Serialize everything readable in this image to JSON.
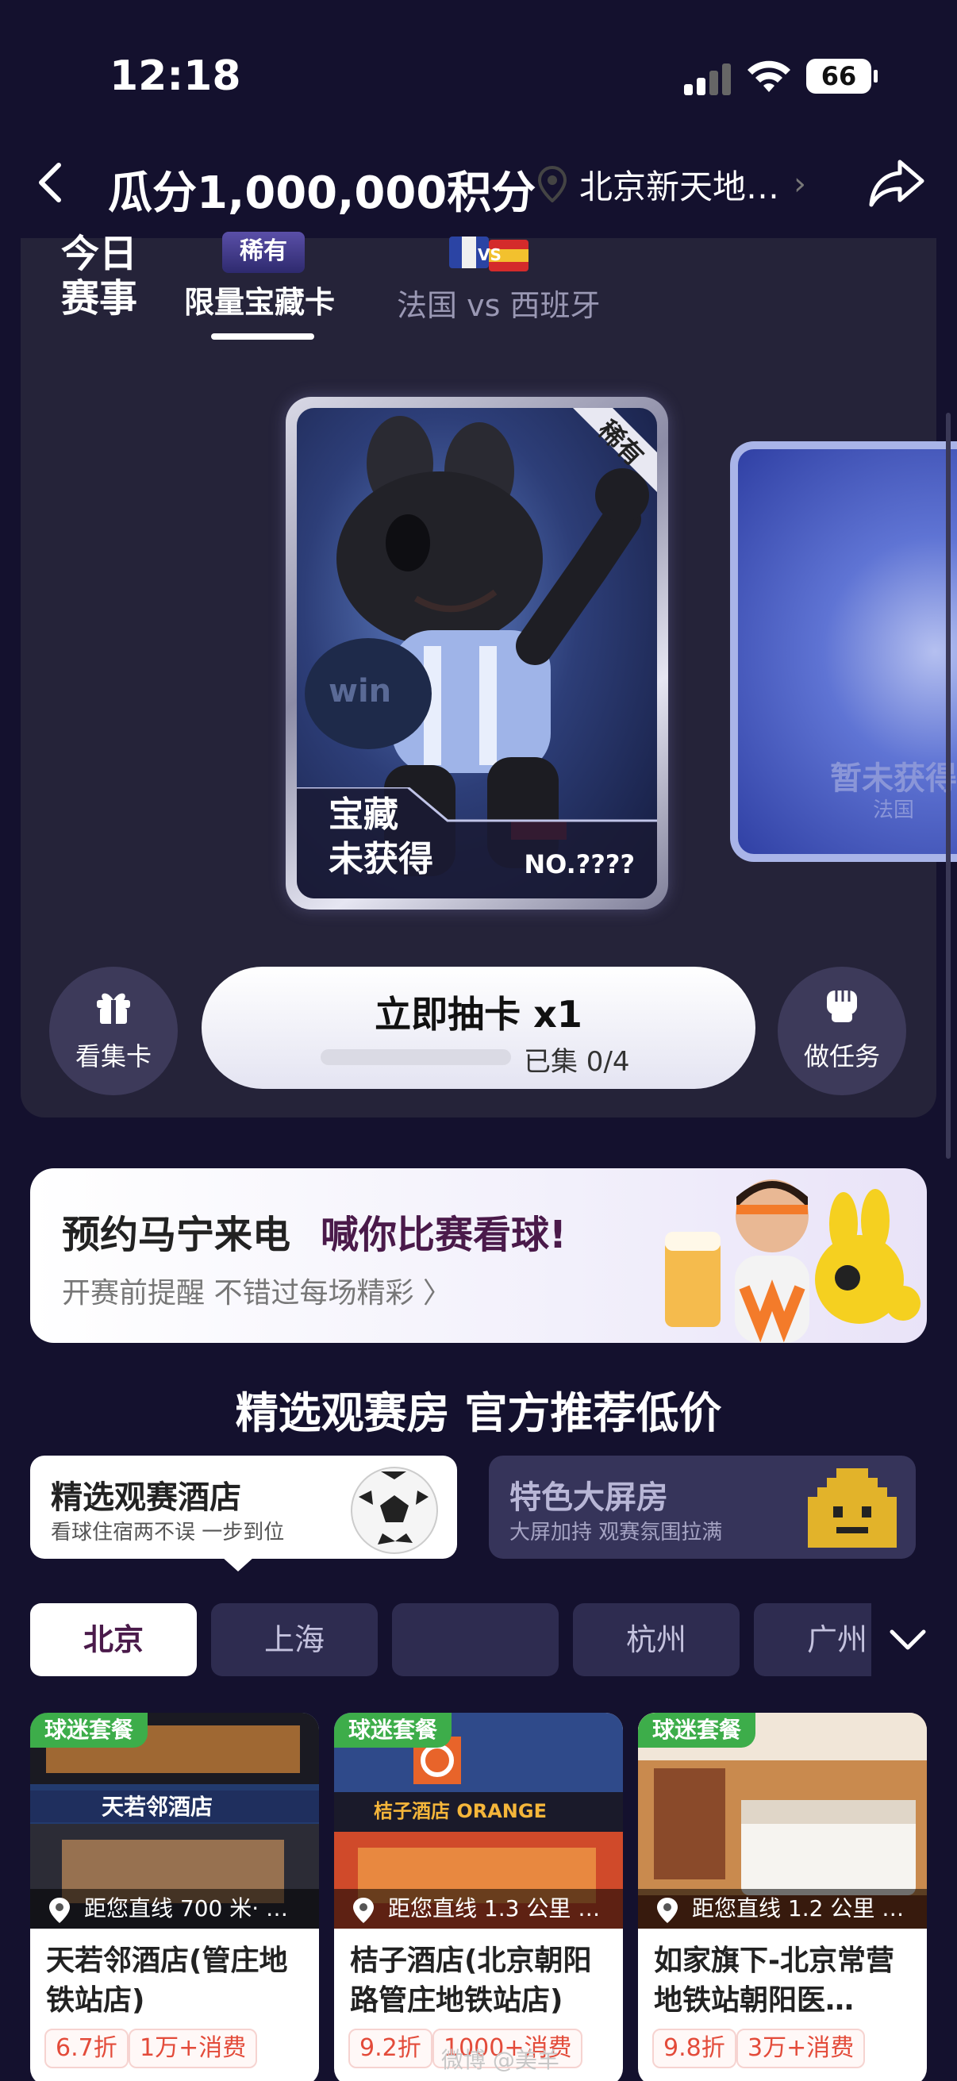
{
  "status_bar": {
    "time": "12:18",
    "battery": "66"
  },
  "header": {
    "title": "瓜分1,000,000积分",
    "location": "北京新天地…"
  },
  "tabs": {
    "today": "今日\n赛事",
    "rare_badge": "稀有",
    "treasure_card": "限量宝藏卡",
    "flag_vs": "VS",
    "match": "法国 vs 西班牙"
  },
  "card_main": {
    "ribbon": "稀有",
    "status_line1": "宝藏",
    "status_line2": "未获得",
    "number": "NO.????"
  },
  "card_second": {
    "title": "暂未获得",
    "subtitle": "法国"
  },
  "actions": {
    "collection_label": "看集卡",
    "task_label": "做任务",
    "draw_title": "立即抽卡 x1",
    "draw_progress_text": "已集 0/4",
    "draw_progress_value": 0
  },
  "banner": {
    "title_a": "预约马宁来电",
    "title_b": "喊你比赛看球!",
    "subtitle": "开赛前提醒 不错过每场精彩 〉"
  },
  "section_title": "精选观赛房 官方推荐低价",
  "hotel_tabs": [
    {
      "title": "精选观赛酒店",
      "subtitle": "看球住宿两不误 一步到位"
    },
    {
      "title": "特色大屏房",
      "subtitle": "大屏加持 观赛氛围拉满"
    }
  ],
  "cities": [
    "北京",
    "上海",
    "",
    "杭州",
    "广州"
  ],
  "hotels": [
    {
      "tag": "球迷套餐",
      "sign": "天若邻酒店",
      "distance": "距您直线 700 米· …",
      "name": "天若邻酒店(管庄地铁站店)",
      "discount": "6.7折",
      "sales": "1万+消费"
    },
    {
      "tag": "球迷套餐",
      "sign": "桔子酒店 ORANGE",
      "distance": "距您直线 1.3 公里 …",
      "name": "桔子酒店(北京朝阳路管庄地铁站店)",
      "discount": "9.2折",
      "sales": "1000+消费"
    },
    {
      "tag": "球迷套餐",
      "sign": "",
      "distance": "距您直线 1.2 公里 …",
      "name": "如家旗下-北京常营地铁站朝阳医…",
      "discount": "9.8折",
      "sales": "3万+消费"
    }
  ],
  "watermark": "微博 @美羊",
  "colors": {
    "background": "#14112e",
    "panel": "#252339",
    "accent_tag": "#3dad4a",
    "price_red": "#e34b3a"
  }
}
